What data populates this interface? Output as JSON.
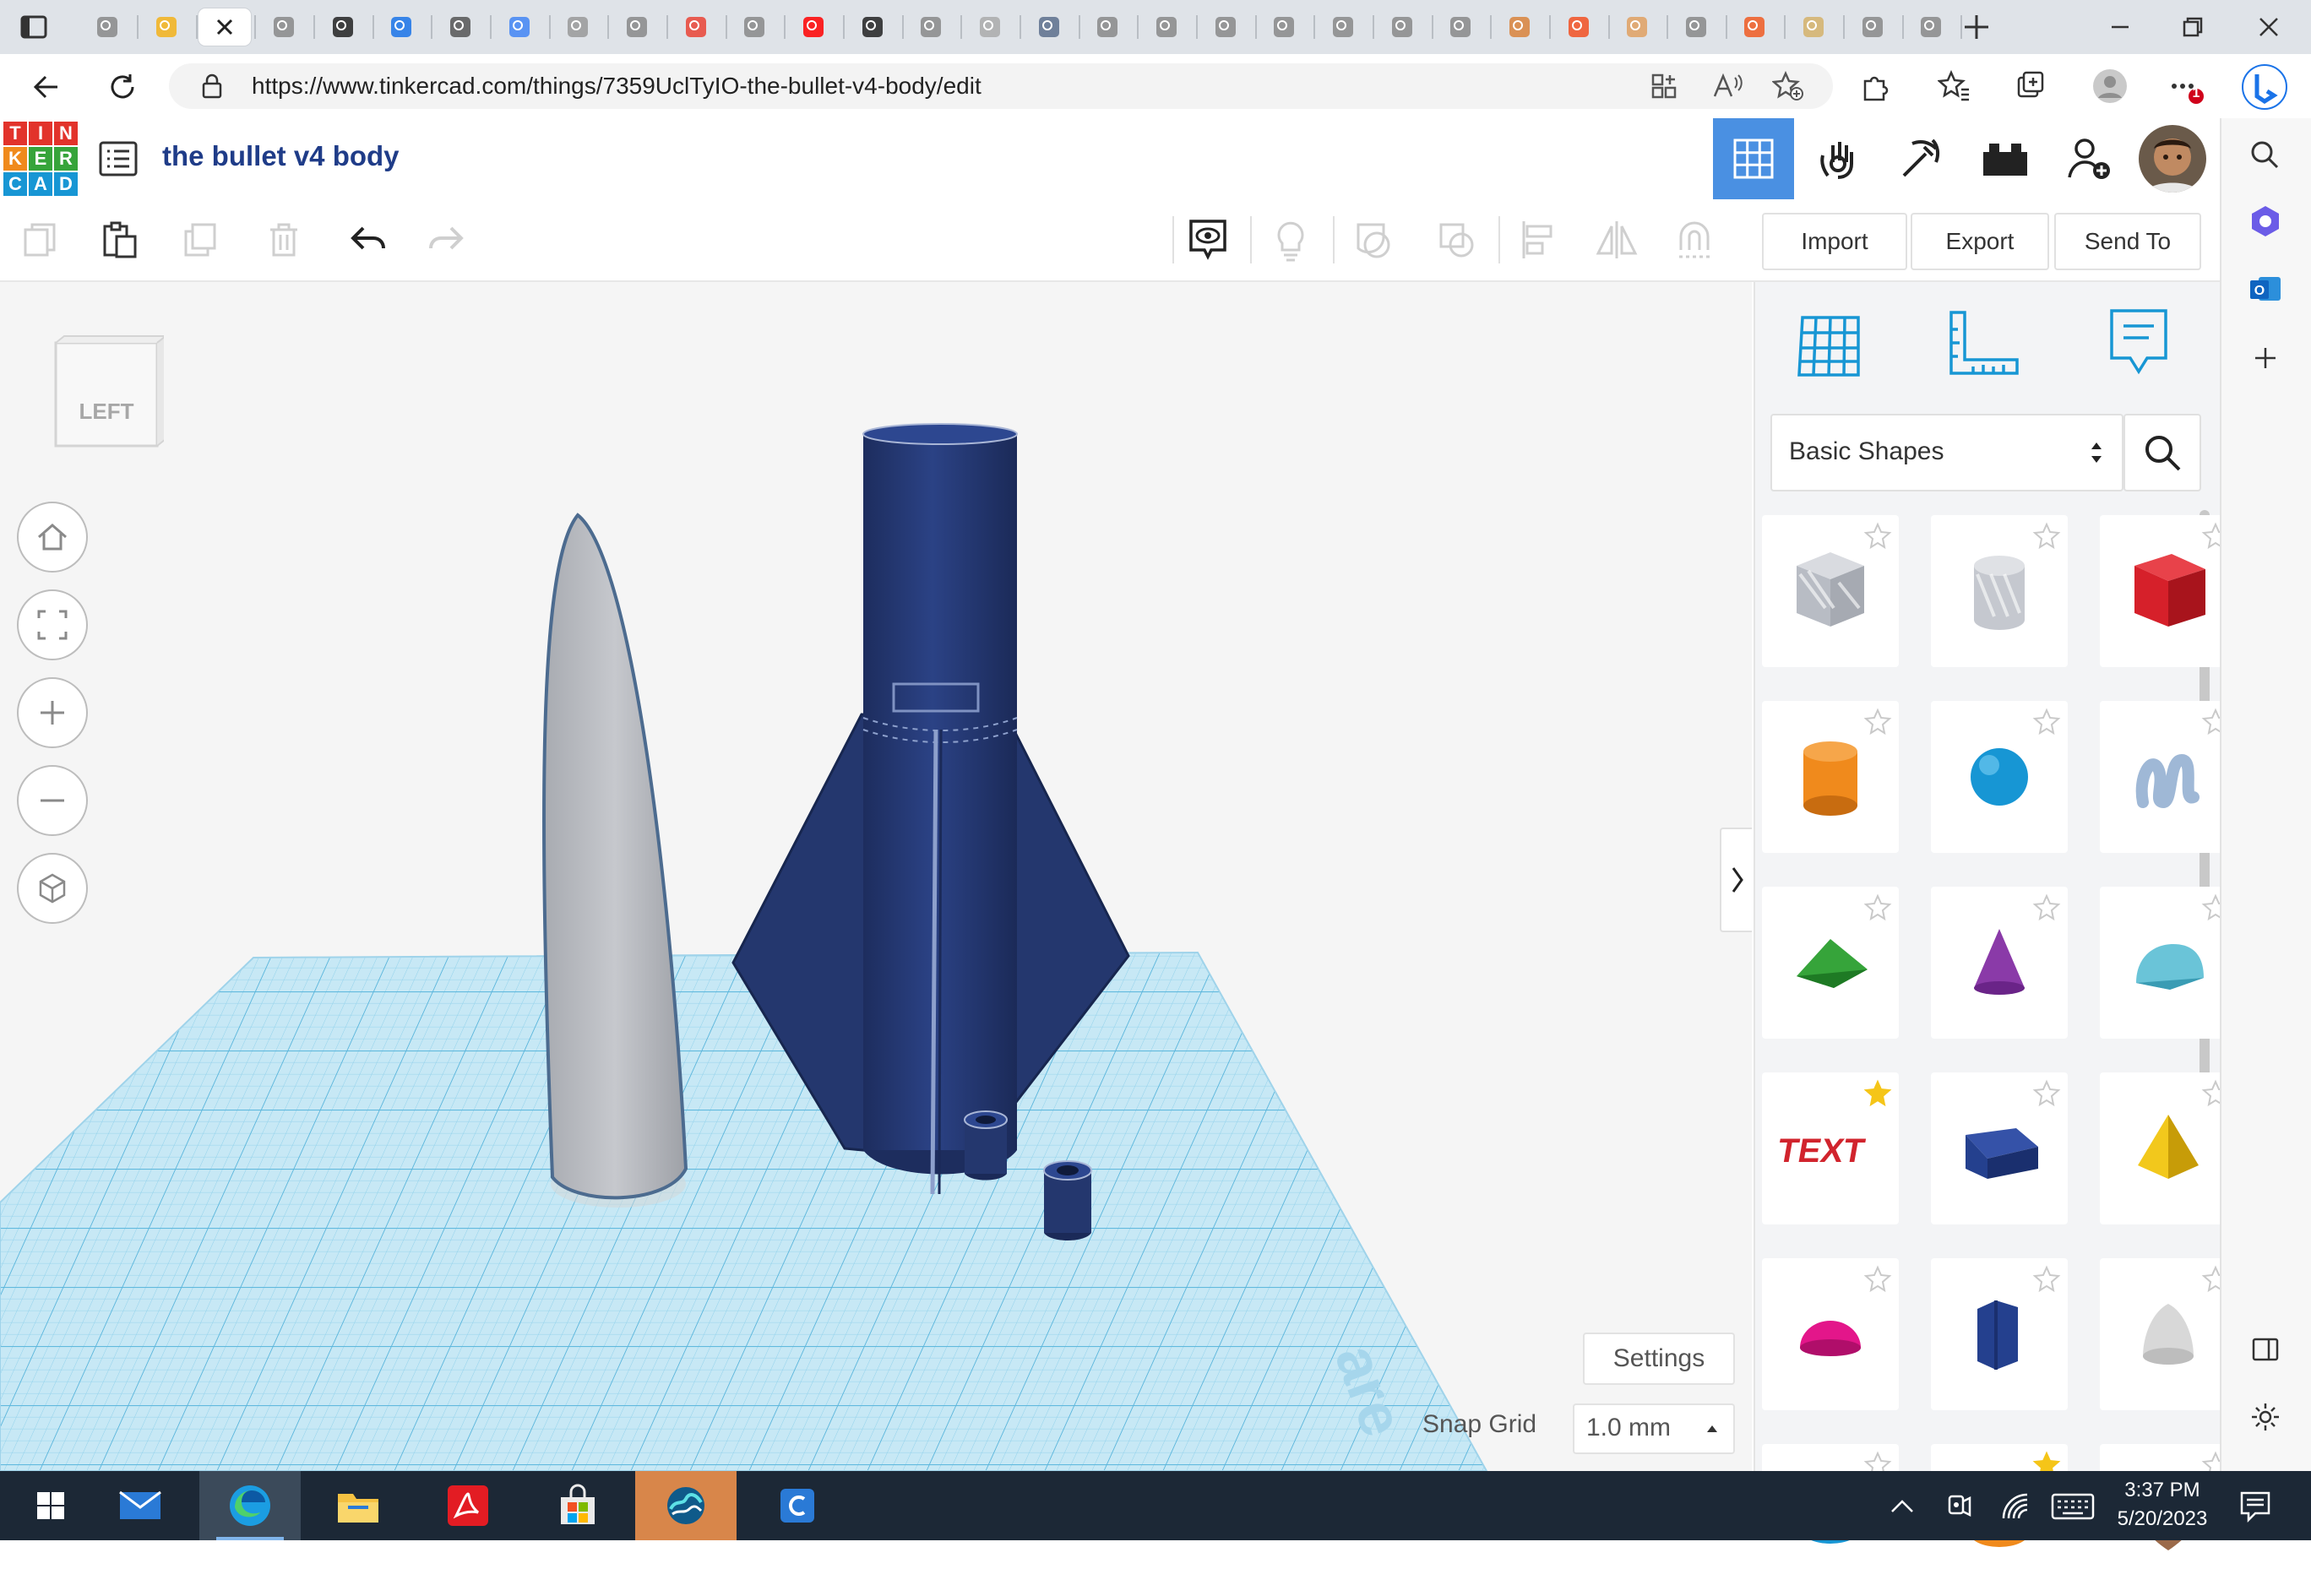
{
  "browser": {
    "tab_count": 32,
    "active_tab_index": 2,
    "url": "https://www.tinkercad.com/things/7359UclTyIO-the-bullet-v4-body/edit",
    "notification_count": "1"
  },
  "app": {
    "logo_letters": [
      "T",
      "I",
      "N",
      "K",
      "E",
      "R",
      "C",
      "A",
      "D"
    ],
    "design_title": "the bullet v4 body",
    "accent": "#1f3c88",
    "active_view_color": "#4a90e2"
  },
  "toolbar": {
    "import_label": "Import",
    "export_label": "Export",
    "send_to_label": "Send To"
  },
  "viewcube": {
    "face_label": "LEFT"
  },
  "panel": {
    "category_value": "Basic Shapes",
    "shapes": [
      {
        "name": "Box Hole",
        "color": "#b8bcc4",
        "favorite": false
      },
      {
        "name": "Cylinder Hole",
        "color": "#c5c8cf",
        "favorite": false
      },
      {
        "name": "Box",
        "color": "#d6202a",
        "favorite": false
      },
      {
        "name": "Cylinder",
        "color": "#f08a1c",
        "favorite": false
      },
      {
        "name": "Sphere",
        "color": "#1796d4",
        "favorite": false
      },
      {
        "name": "Scribble",
        "color": "#9fb8d6",
        "favorite": false
      },
      {
        "name": "Roof",
        "color": "#36a43a",
        "favorite": false
      },
      {
        "name": "Cone",
        "color": "#8a3aa8",
        "favorite": false
      },
      {
        "name": "Round Roof",
        "color": "#6ac4d8",
        "favorite": false
      },
      {
        "name": "Text",
        "color": "#d1242d",
        "favorite": true
      },
      {
        "name": "Wedge",
        "color": "#24408e",
        "favorite": false
      },
      {
        "name": "Pyramid",
        "color": "#f2c81c",
        "favorite": false
      },
      {
        "name": "Half Sphere",
        "color": "#e3168a",
        "favorite": false
      },
      {
        "name": "Polygon",
        "color": "#24408e",
        "favorite": false
      },
      {
        "name": "Paraboloid",
        "color": "#d8d8d8",
        "favorite": false
      },
      {
        "name": "Torus",
        "color": "#1796d4",
        "favorite": false
      },
      {
        "name": "Tube",
        "color": "#f08a1c",
        "favorite": true
      },
      {
        "name": "Heart",
        "color": "#9b6a4a",
        "favorite": false
      }
    ]
  },
  "workplane": {
    "settings_label": "Settings",
    "snap_grid_label": "Snap Grid",
    "snap_grid_value": "1.0 mm",
    "nosecone_color": "#b9bcc2",
    "body_color": "#24376e"
  },
  "taskbar": {
    "time": "3:37 PM",
    "date": "5/20/2023"
  }
}
